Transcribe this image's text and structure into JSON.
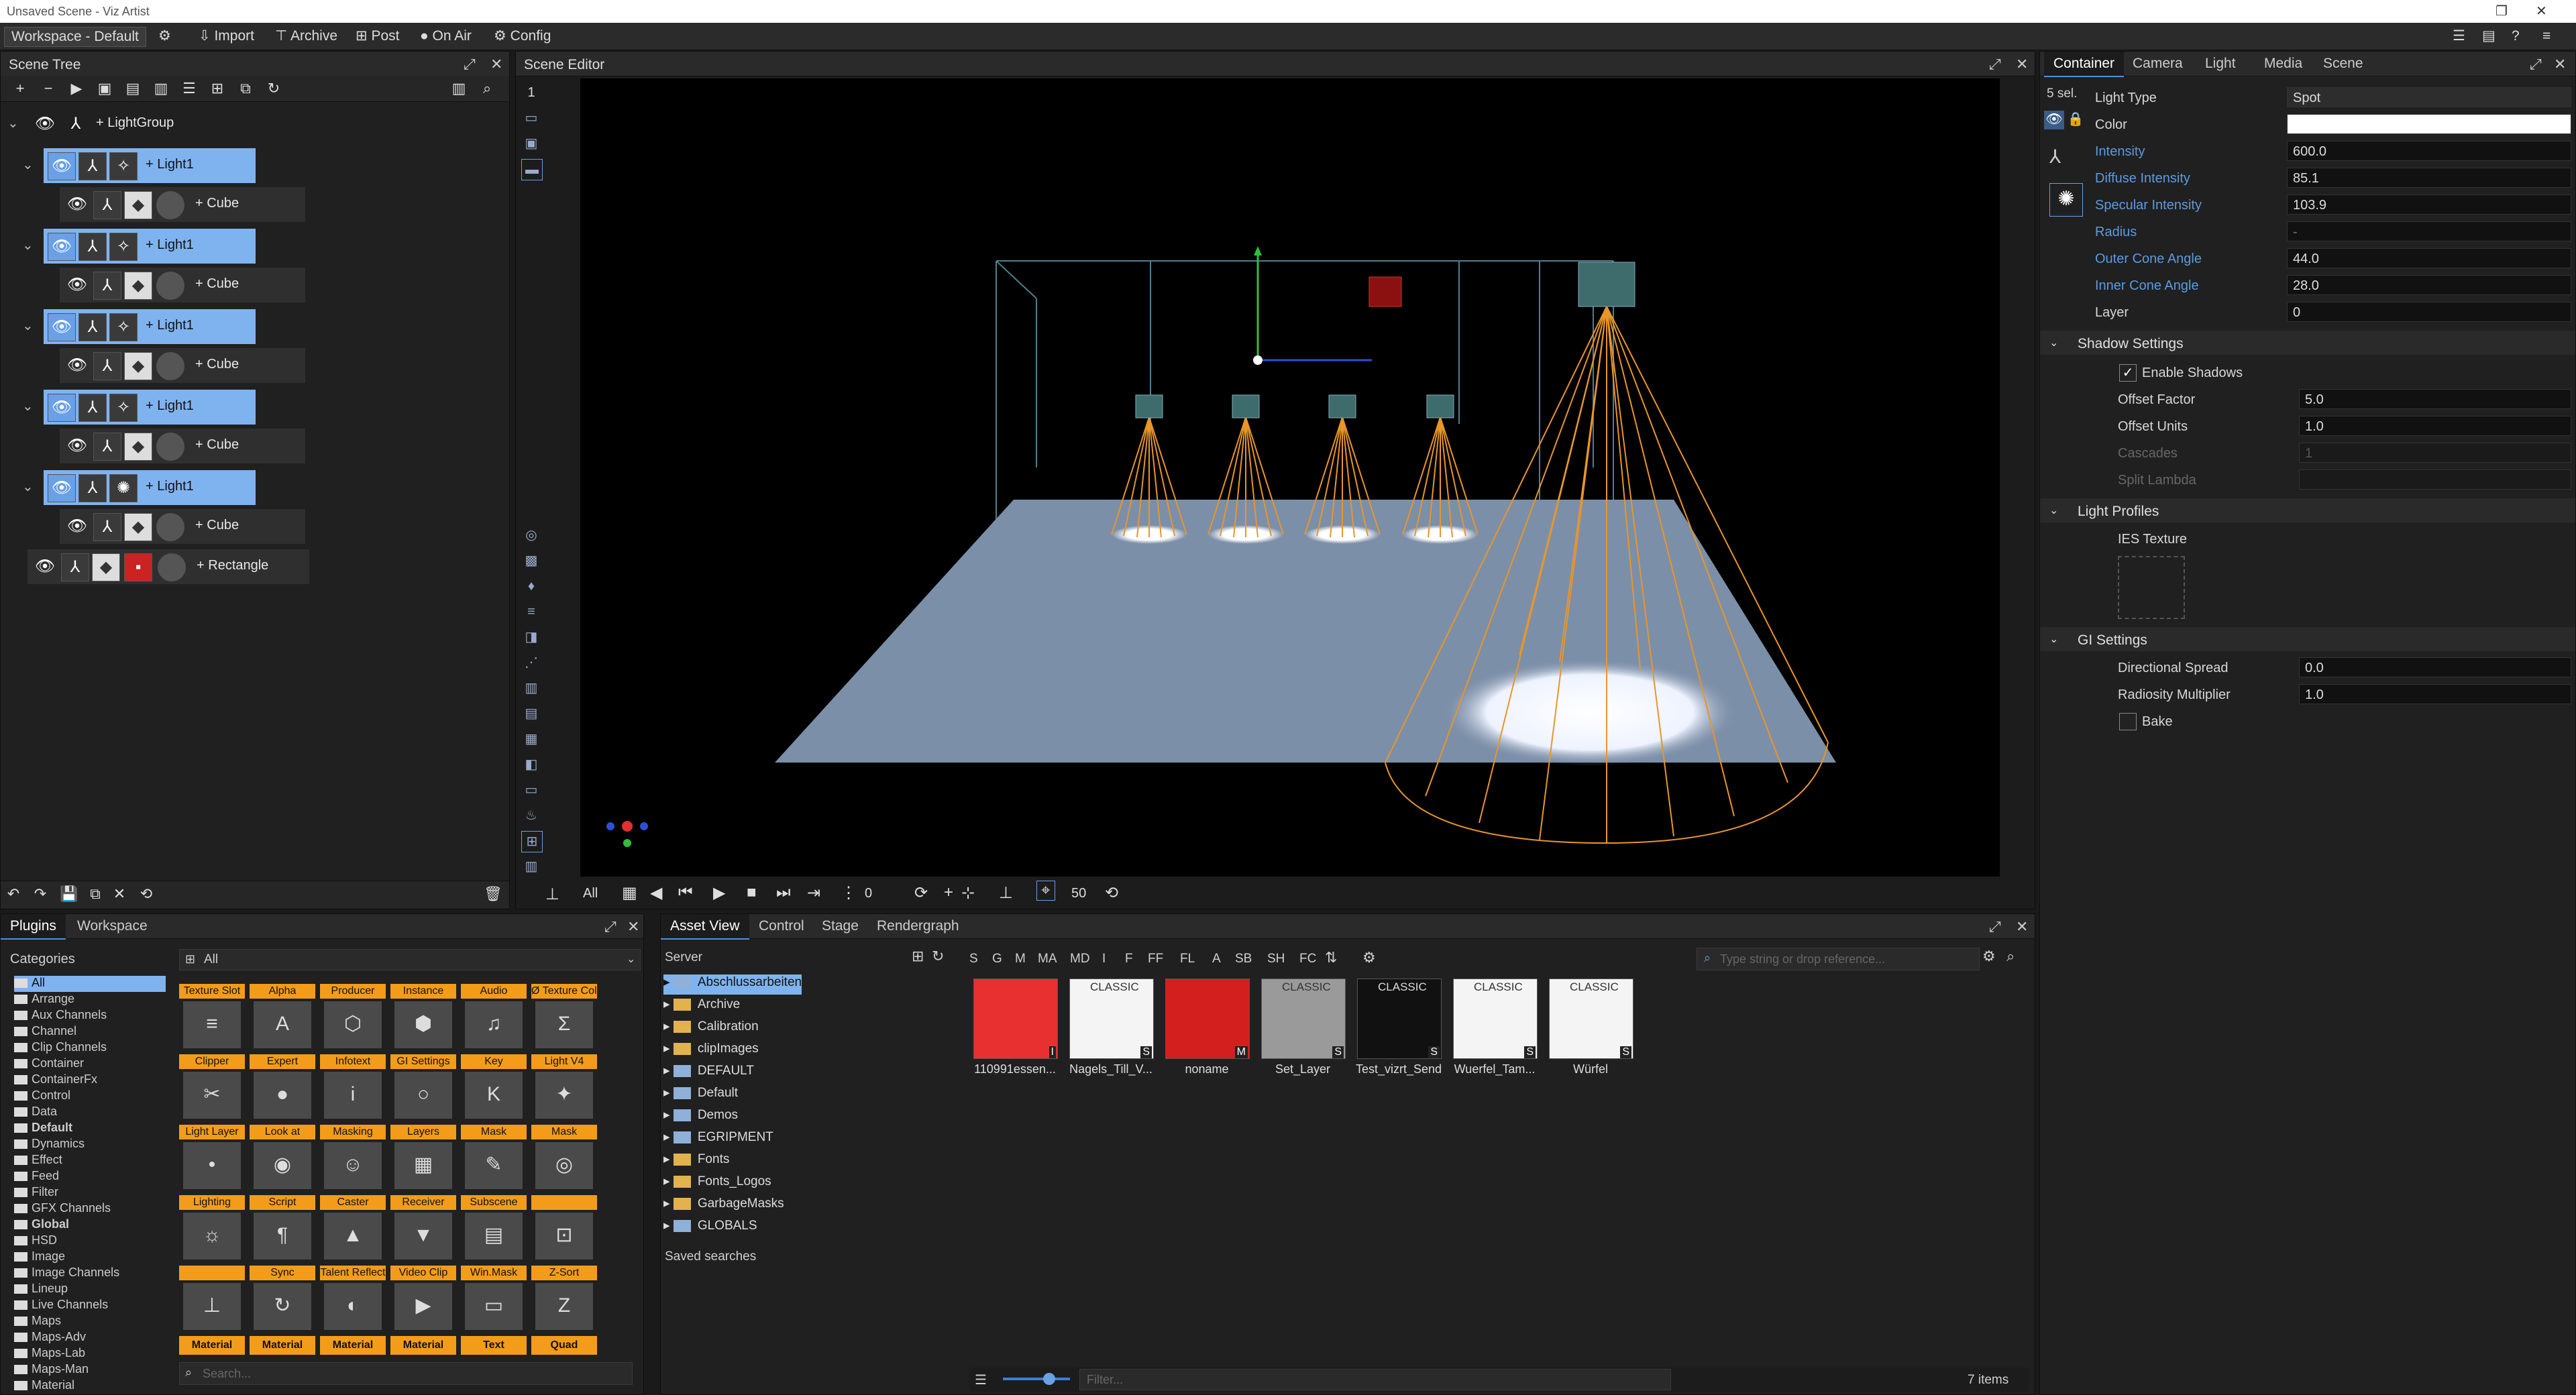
{
  "window": {
    "title": "Unsaved Scene - Viz Artist"
  },
  "toolbar": {
    "workspace": "Workspace - Default",
    "import": "Import",
    "archive": "Archive",
    "post": "Post",
    "on_air": "On Air",
    "config": "Config"
  },
  "scene_tree": {
    "title": "Scene Tree",
    "root": "LightGroup",
    "light_label": "Light1",
    "cube_label": "Cube",
    "rectangle_label": "Rectangle"
  },
  "scene_editor": {
    "title": "Scene Editor",
    "side_numbers": [
      "1"
    ],
    "playback": {
      "all": "All",
      "start": "0",
      "end": "50"
    }
  },
  "properties": {
    "tabs": [
      "Container",
      "Camera",
      "Light",
      "Media",
      "Scene"
    ],
    "selection": "5 sel.",
    "fields": {
      "light_type": {
        "label": "Light Type",
        "value": "Spot"
      },
      "color": {
        "label": "Color",
        "value": "#ffffff"
      },
      "intensity": {
        "label": "Intensity",
        "value": "600.0"
      },
      "diffuse": {
        "label": "Diffuse Intensity",
        "value": "85.1"
      },
      "specular": {
        "label": "Specular Intensity",
        "value": "103.9"
      },
      "radius": {
        "label": "Radius",
        "value": "-"
      },
      "outer_cone": {
        "label": "Outer Cone Angle",
        "value": "44.0"
      },
      "inner_cone": {
        "label": "Inner Cone Angle",
        "value": "28.0"
      },
      "layer": {
        "label": "Layer",
        "value": "0"
      }
    },
    "shadow": {
      "title": "Shadow Settings",
      "enable": "Enable Shadows",
      "offset_factor": {
        "label": "Offset Factor",
        "value": "5.0"
      },
      "offset_units": {
        "label": "Offset Units",
        "value": "1.0"
      },
      "cascades": {
        "label": "Cascades",
        "value": "1"
      },
      "split_lambda": {
        "label": "Split Lambda",
        "value": ""
      }
    },
    "profiles": {
      "title": "Light Profiles",
      "ies": "IES Texture"
    },
    "gi": {
      "title": "GI Settings",
      "spread": {
        "label": "Directional Spread",
        "value": "0.0"
      },
      "radiosity": {
        "label": "Radiosity Multiplier",
        "value": "1.0"
      },
      "bake": "Bake"
    }
  },
  "plugins": {
    "tabs": [
      "Plugins",
      "Workspace"
    ],
    "categories_title": "Categories",
    "filter": "All",
    "search_placeholder": "Search...",
    "categories": [
      "All",
      "Arrange",
      "Aux Channels",
      "Channel",
      "Clip Channels",
      "Container",
      "ContainerFx",
      "Control",
      "Data",
      "Default",
      "Dynamics",
      "Effect",
      "Feed",
      "Filter",
      "GFX Channels",
      "Global",
      "HSD",
      "Image",
      "Image Channels",
      "Lineup",
      "Live Channels",
      "Maps",
      "Maps-Adv",
      "Maps-Lab",
      "Maps-Man",
      "Material"
    ],
    "items": [
      {
        "label": "Texture Slot",
        "glyph": "≡"
      },
      {
        "label": "Alpha",
        "glyph": "A"
      },
      {
        "label": "Producer",
        "glyph": "⬡"
      },
      {
        "label": "Instance",
        "glyph": "⬢"
      },
      {
        "label": "Audio",
        "glyph": "♫"
      },
      {
        "label": "Ø Texture Color",
        "glyph": "Σ"
      },
      {
        "label": "Clipper",
        "glyph": "✂"
      },
      {
        "label": "Expert",
        "glyph": "●"
      },
      {
        "label": "Infotext",
        "glyph": "i"
      },
      {
        "label": "GI Settings",
        "glyph": "○"
      },
      {
        "label": "Key",
        "glyph": "K"
      },
      {
        "label": "Light V4",
        "glyph": "✦"
      },
      {
        "label": "Light Layer",
        "glyph": "•"
      },
      {
        "label": "Look at",
        "glyph": "◉"
      },
      {
        "label": "Masking",
        "glyph": "☺"
      },
      {
        "label": "Layers",
        "glyph": "▦"
      },
      {
        "label": "Mask",
        "glyph": "✎"
      },
      {
        "label": "Mask",
        "glyph": "◎"
      },
      {
        "label": "Lighting",
        "glyph": "☼"
      },
      {
        "label": "Script",
        "glyph": "¶"
      },
      {
        "label": "Caster",
        "glyph": "▲"
      },
      {
        "label": "Receiver",
        "glyph": "▼"
      },
      {
        "label": "Subscene",
        "glyph": "▤"
      },
      {
        "label": "",
        "glyph": "⊡"
      },
      {
        "label": "",
        "glyph": "⊥"
      },
      {
        "label": "Sync",
        "glyph": "↻"
      },
      {
        "label": "Talent Reflect",
        "glyph": "◐"
      },
      {
        "label": "Video Clip",
        "glyph": "▶"
      },
      {
        "label": "Win.Mask",
        "glyph": "▭"
      },
      {
        "label": "Z-Sort",
        "glyph": "Z"
      },
      {
        "label": "Material",
        "glyph": ""
      },
      {
        "label": "Material",
        "glyph": ""
      },
      {
        "label": "Material",
        "glyph": ""
      },
      {
        "label": "Material",
        "glyph": ""
      },
      {
        "label": "Text",
        "glyph": ""
      },
      {
        "label": "Quad",
        "glyph": ""
      }
    ]
  },
  "asset_view": {
    "tabs": [
      "Asset View",
      "Control",
      "Stage",
      "Rendergraph"
    ],
    "server_label": "Server",
    "filters": [
      "S",
      "G",
      "M",
      "MA",
      "MD",
      "I",
      "F",
      "FF",
      "FL",
      "A",
      "SB",
      "SH",
      "FC"
    ],
    "search_placeholder": "Type string or drop reference...",
    "folders": [
      "Abschlussarbeiten",
      "Archive",
      "Calibration",
      "clipImages",
      "DEFAULT",
      "Default",
      "Demos",
      "EGRIPMENT",
      "Fonts",
      "Fonts_Logos",
      "GarbageMasks",
      "GLOBALS"
    ],
    "saved_searches": "Saved searches",
    "filter_placeholder": "Filter...",
    "count": "7 items",
    "assets": [
      {
        "name": "110991essen...",
        "tag": "",
        "corner": "I",
        "color": "#e83030"
      },
      {
        "name": "Nagels_Till_V...",
        "tag": "CLASSIC",
        "corner": "S",
        "color": "#f4f4f4"
      },
      {
        "name": "noname",
        "tag": "",
        "corner": "M",
        "color": "#d41f1f"
      },
      {
        "name": "Set_Layer",
        "tag": "CLASSIC",
        "corner": "S",
        "color": "#9a9a9a"
      },
      {
        "name": "Test_vizrt_Send",
        "tag": "CLASSIC",
        "corner": "S",
        "color": "#111111"
      },
      {
        "name": "Wuerfel_Tam...",
        "tag": "CLASSIC",
        "corner": "S",
        "color": "#f4f4f4"
      },
      {
        "name": "Würfel",
        "tag": "CLASSIC",
        "corner": "S",
        "color": "#f4f4f4"
      }
    ]
  }
}
